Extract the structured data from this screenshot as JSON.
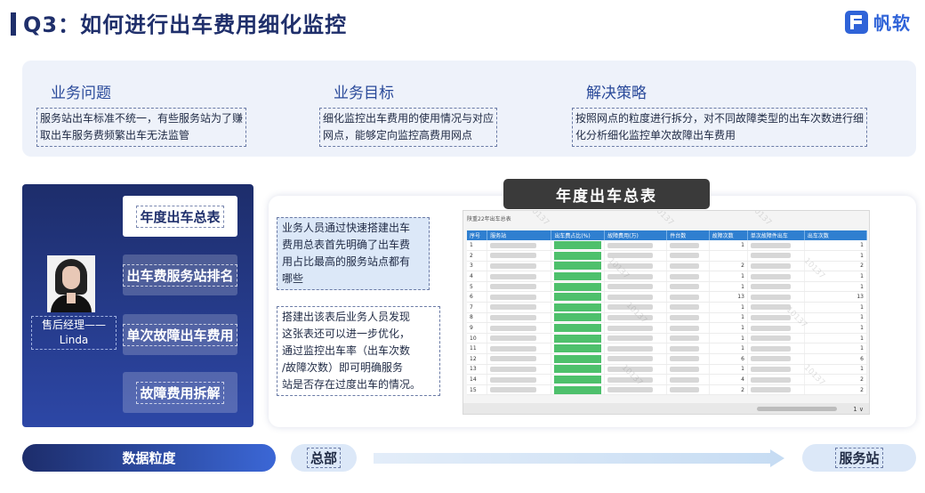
{
  "header": {
    "title": "Q3：如何进行出车费用细化监控",
    "logo_text": "帆软",
    "logo_icon": "fanruan-logo-icon"
  },
  "info": {
    "problem": {
      "title": "业务问题",
      "lines": [
        "服务站出车标准不统一，有些服务站为了赚",
        "取出车服务费频繁出车无法监管"
      ]
    },
    "goal": {
      "title": "业务目标",
      "lines": [
        "细化监控出车费用的使用情况与对应",
        "网点，能够定向监控高费用网点"
      ]
    },
    "strategy": {
      "title": "解决策略",
      "lines": [
        "按照网点的粒度进行拆分，对不同故障类型的出车次数进行细",
        "化分析细化监控单次故障出车费用"
      ]
    }
  },
  "persona": {
    "role": "售后经理——",
    "name": "Linda"
  },
  "nav": [
    {
      "label": "年度出车总表",
      "active": true
    },
    {
      "label": "出车费服务站排名",
      "active": false
    },
    {
      "label": "单次故障出车费用",
      "active": false
    },
    {
      "label": "故障费用拆解",
      "active": false
    }
  ],
  "table_title": "年度出车总表",
  "descriptions": {
    "first": [
      "业务人员通过快速搭建出车",
      "费用总表首先明确了出车费",
      "用占比最高的服务站点都有",
      "哪些"
    ],
    "second": [
      "搭建出该表后业务人员发现",
      "这张表还可以进一步优化，",
      "通过监控出车率（出车次数",
      "/故障次数）即可明确服务",
      "站是否存在过度出车的情况。"
    ]
  },
  "screenshot": {
    "caption": "陕重22年出车总表",
    "columns": [
      "序号",
      "服务站",
      "出车费占比(%)",
      "故障费用(万)",
      "件台数",
      "故障次数",
      "单次故障件出车",
      "出车次数"
    ],
    "rows": [
      {
        "id": "1",
        "f": "1",
        "c": "1"
      },
      {
        "id": "2",
        "f": "",
        "c": "1"
      },
      {
        "id": "3",
        "f": "2",
        "c": "2"
      },
      {
        "id": "4",
        "f": "1",
        "c": "1"
      },
      {
        "id": "5",
        "f": "1",
        "c": "1"
      },
      {
        "id": "6",
        "f": "13",
        "c": "13"
      },
      {
        "id": "7",
        "f": "1",
        "c": "1"
      },
      {
        "id": "8",
        "f": "1",
        "c": "1"
      },
      {
        "id": "9",
        "f": "1",
        "c": "1"
      },
      {
        "id": "10",
        "f": "1",
        "c": "1"
      },
      {
        "id": "11",
        "f": "1",
        "c": "1"
      },
      {
        "id": "12",
        "f": "6",
        "c": "6"
      },
      {
        "id": "13",
        "f": "1",
        "c": "1"
      },
      {
        "id": "14",
        "f": "4",
        "c": "2"
      },
      {
        "id": "15",
        "f": "2",
        "c": "2"
      }
    ],
    "page_info": "1 ∨",
    "watermark": "10137"
  },
  "bottom": {
    "granularity": "数据粒度",
    "start": "总部",
    "end": "服务站"
  },
  "colors": {
    "navy": "#1f2f6b",
    "accent_blue": "#2f63d8",
    "panel_bg": "#eef2fa",
    "desc_bg": "#dce8f8",
    "table_header": "#2f7fd0",
    "bar_green": "#4ec06c"
  }
}
